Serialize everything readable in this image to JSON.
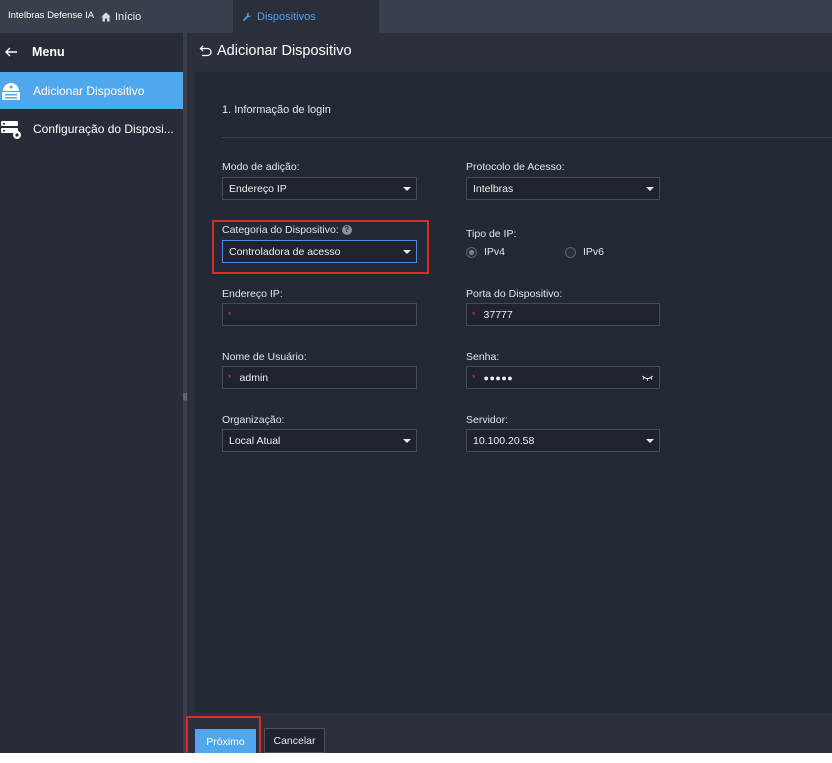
{
  "app": {
    "brand": "Intelbras Defense IA"
  },
  "tabs": [
    {
      "label": "Início",
      "icon": "home-icon"
    },
    {
      "label": "Dispositivos",
      "icon": "wrench-icon",
      "active": true
    }
  ],
  "sidebar": {
    "menu_label": "Menu",
    "items": [
      {
        "label": "Adicionar Dispositivo",
        "icon": "add-device-icon",
        "active": true
      },
      {
        "label": "Configuração do Disposi...",
        "icon": "device-config-icon",
        "active": false
      }
    ]
  },
  "page": {
    "title": "Adicionar Dispositivo",
    "section": "1. Informação de login"
  },
  "form": {
    "add_mode": {
      "label": "Modo de adição:",
      "value": "Endereço IP"
    },
    "protocol": {
      "label": "Protocolo de Acesso:",
      "value": "Intelbras"
    },
    "category": {
      "label": "Categoria do Dispositivo:",
      "value": "Controladora de acesso",
      "help": "?"
    },
    "ip_type": {
      "label": "Tipo de IP:",
      "options": [
        "IPv4",
        "IPv6"
      ],
      "selected": "IPv4"
    },
    "ip_address": {
      "label": "Endereço IP:",
      "value": "",
      "required_mark": "*"
    },
    "port": {
      "label": "Porta do Dispositivo:",
      "value": "37777",
      "required_mark": "*"
    },
    "username": {
      "label": "Nome de Usuário:",
      "value": "admin",
      "required_mark": "*"
    },
    "password": {
      "label": "Senha:",
      "value": "●●●●●",
      "required_mark": "*"
    },
    "organization": {
      "label": "Organização:",
      "value": "Local Atual"
    },
    "server": {
      "label": "Servidor:",
      "value": "10.100.20.58"
    }
  },
  "footer": {
    "next_label": "Próximo",
    "cancel_label": "Cancelar"
  },
  "colors": {
    "accent": "#4fa7ee",
    "highlight": "#e02a2a",
    "required": "#e0344a"
  }
}
